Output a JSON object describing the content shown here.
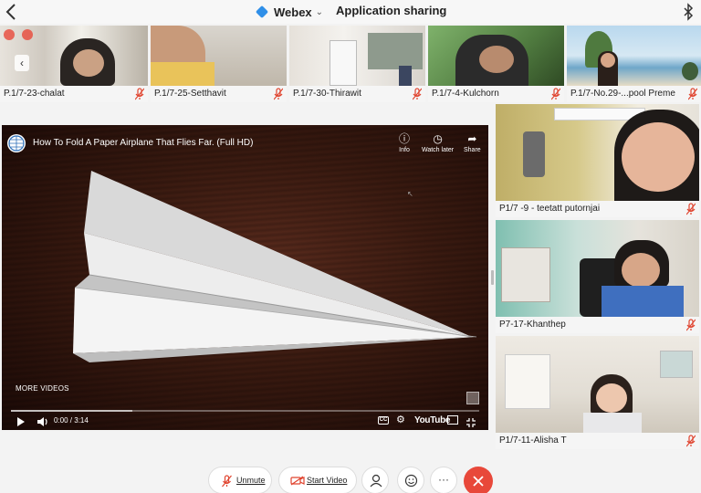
{
  "topbar": {
    "webex_title": "Webex",
    "mode_title": "Application sharing"
  },
  "participants_top": [
    {
      "name": "P.1/7-23-chalat",
      "muted": true
    },
    {
      "name": "P.1/7-25-Setthavit",
      "muted": true
    },
    {
      "name": "P.1/7-30-Thirawit",
      "muted": true
    },
    {
      "name": "P.1/7-4-Kulchorn",
      "muted": true
    },
    {
      "name": "P.1/7-No.29-...pool Preme",
      "muted": true
    }
  ],
  "participants_side": [
    {
      "name": "P1/7 -9 - teetatt putornjai",
      "muted": true
    },
    {
      "name": "P7-17-Khanthep",
      "muted": true
    },
    {
      "name": "P1/7-11-Alisha T",
      "muted": true
    }
  ],
  "video": {
    "title": "How To Fold A Paper Airplane That Flies Far. (Full HD)",
    "info_label": "Info",
    "watch_later_label": "Watch later",
    "share_label": "Share",
    "more_videos": "MORE VIDEOS",
    "time": "0:00 / 3:14",
    "brand": "YouTube",
    "cc_label": "CC",
    "buffered_fraction": 0.26
  },
  "controls": {
    "unmute_label": "Unmute",
    "start_video_label": "Start Video"
  },
  "colors": {
    "leave": "#e8483a",
    "mute_icon": "#e0442f",
    "webex_accent": "#2f8fe8"
  }
}
